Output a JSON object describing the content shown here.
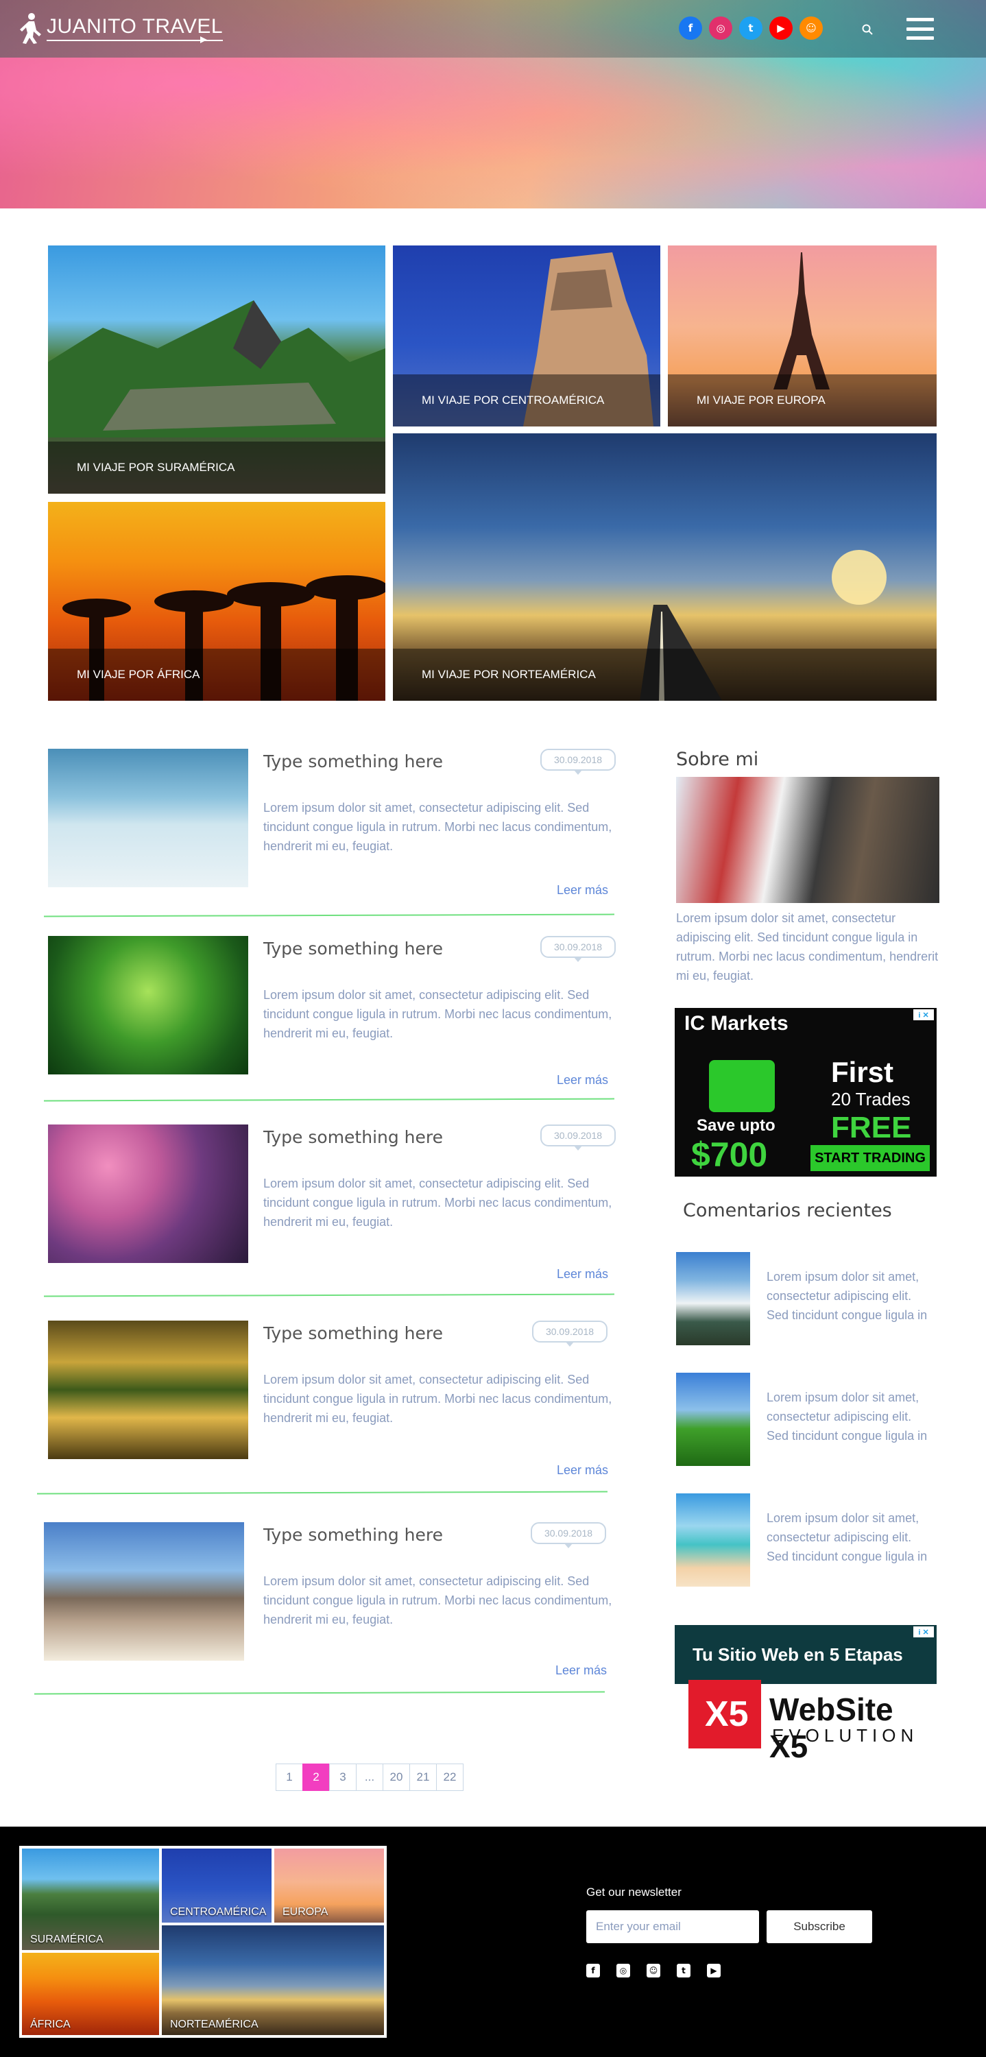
{
  "header": {
    "logo_text": "JUANITO TRAVEL",
    "social": [
      {
        "icon": "facebook-icon",
        "glyph": "f",
        "color": "#1877f2"
      },
      {
        "icon": "instagram-icon",
        "glyph": "◎",
        "color": "#e1306c"
      },
      {
        "icon": "twitter-icon",
        "glyph": "t",
        "color": "#1da1f2"
      },
      {
        "icon": "youtube-icon",
        "glyph": "▶",
        "color": "#ff0000"
      },
      {
        "icon": "snapchat-icon",
        "glyph": "☺",
        "color": "#ff8a00"
      }
    ]
  },
  "destinations": {
    "suramerica": "MI VIAJE POR SURAMÉRICA",
    "centroamerica": "MI VIAJE POR CENTROAMÉRICA",
    "europa": "MI VIAJE POR EUROPA",
    "africa": "MI VIAJE POR ÁFRICA",
    "norteamerica": "MI VIAJE POR NORTEAMÉRICA"
  },
  "posts": [
    {
      "title": "Type something here",
      "date": "30.09.2018",
      "excerpt": "Lorem ipsum dolor sit amet, consectetur adipiscing elit. Sed tincidunt congue ligula in rutrum. Morbi nec lacus condimentum, hendrerit mi eu, feugiat.",
      "more": "Leer más"
    },
    {
      "title": "Type something here",
      "date": "30.09.2018",
      "excerpt": "Lorem ipsum dolor sit amet, consectetur adipiscing elit. Sed tincidunt congue ligula in rutrum. Morbi nec lacus condimentum, hendrerit mi eu, feugiat.",
      "more": "Leer más"
    },
    {
      "title": "Type something here",
      "date": "30.09.2018",
      "excerpt": "Lorem ipsum dolor sit amet, consectetur adipiscing elit. Sed tincidunt congue ligula in rutrum. Morbi nec lacus condimentum, hendrerit mi eu, feugiat.",
      "more": "Leer más"
    },
    {
      "title": "Type something here",
      "date": "30.09.2018",
      "excerpt": "Lorem ipsum dolor sit amet, consectetur adipiscing elit. Sed tincidunt congue ligula in rutrum. Morbi nec lacus condimentum, hendrerit mi eu, feugiat.",
      "more": "Leer más"
    },
    {
      "title": "Type something here",
      "date": "30.09.2018",
      "excerpt": "Lorem ipsum dolor sit amet, consectetur adipiscing elit. Sed tincidunt congue ligula in rutrum. Morbi nec lacus condimentum, hendrerit mi eu, feugiat.",
      "more": "Leer más"
    }
  ],
  "sidebar": {
    "about_title": "Sobre mi",
    "about_text": "Lorem ipsum dolor sit amet, consectetur adipiscing elit. Sed tincidunt congue ligula in rutrum. Morbi nec lacus condimentum, hendrerit mi eu, feugiat.",
    "ad1": {
      "brand": "IC Markets",
      "line1": "First",
      "line2": "20 Trades",
      "line3": "FREE",
      "save": "Save upto",
      "amount": "$700",
      "cta": "START TRADING"
    },
    "recent_title": "Comentarios recientes",
    "recent": [
      {
        "text": "Lorem ipsum dolor sit amet, consectetur adipiscing elit. Sed tincidunt congue ligula in"
      },
      {
        "text": "Lorem ipsum dolor sit amet, consectetur adipiscing elit. Sed tincidunt congue ligula in"
      },
      {
        "text": "Lorem ipsum dolor sit amet, consectetur adipiscing elit. Sed tincidunt congue ligula in"
      }
    ],
    "ad2": {
      "headline": "Tu Sitio Web en 5 Etapas",
      "brand": "WebSite X5",
      "sub": "EVOLUTION"
    }
  },
  "pagination": {
    "pages": [
      "1",
      "2",
      "3",
      "...",
      "20",
      "21",
      "22"
    ],
    "current": "2"
  },
  "footer": {
    "tiles": {
      "suramerica": "SURAMÉRICA",
      "centroamerica": "CENTROAMÉRICA",
      "europa": "EUROPA",
      "africa": "ÁFRICA",
      "norteamerica": "NORTEAMÉRICA"
    },
    "newsletter_label": "Get our newsletter",
    "email_placeholder": "Enter your email",
    "subscribe_label": "Subscribe",
    "social": [
      "facebook-icon",
      "instagram-icon",
      "snapchat-icon",
      "twitter-icon",
      "youtube-icon"
    ]
  }
}
